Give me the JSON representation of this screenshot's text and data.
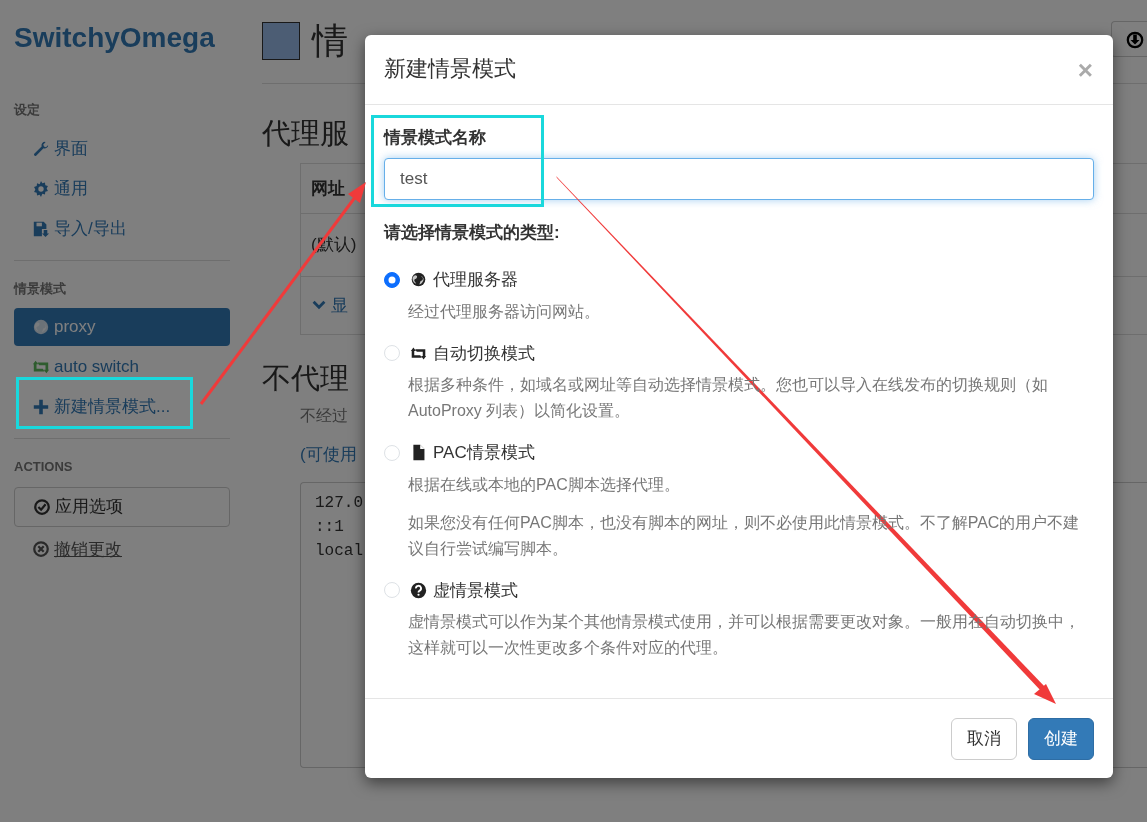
{
  "sidebar": {
    "logo": "SwitchyOmega",
    "sections": [
      {
        "header": "设定",
        "items": [
          {
            "label": "界面",
            "selected": false
          },
          {
            "label": "通用",
            "selected": false
          },
          {
            "label": "导入/导出",
            "selected": false
          }
        ]
      },
      {
        "header": "情景模式",
        "items": [
          {
            "label": "proxy",
            "selected": true
          },
          {
            "label": "auto switch",
            "selected": false
          },
          {
            "label": "新建情景模式...",
            "selected": false
          }
        ]
      }
    ],
    "actions_header": "ACTIONS",
    "actions": [
      {
        "label": "应用选项",
        "kind": "button"
      },
      {
        "label": "撤销更改",
        "kind": "link"
      }
    ]
  },
  "main": {
    "title": "情",
    "section_1": "代理服",
    "table_header": "网址",
    "table_cell": "(默认)",
    "toggle": "显",
    "section_2": "不代理",
    "hint": "不经过",
    "link": "(可使用",
    "bypass_list": [
      "127.0",
      "::1",
      "local"
    ]
  },
  "dialog": {
    "title": "新建情景模式",
    "close": "×",
    "name_label": "情景模式名称",
    "name_value": "test",
    "type_label": "请选择情景模式的类型:",
    "types": [
      {
        "label": "代理服务器",
        "selected": true,
        "descriptions": [
          "经过代理服务器访问网站。"
        ]
      },
      {
        "label": "自动切换模式",
        "selected": false,
        "descriptions": [
          "根据多种条件，如域名或网址等自动选择情景模式。您也可以导入在线发布的切换规则（如 AutoProxy 列表）以简化设置。"
        ]
      },
      {
        "label": "PAC情景模式",
        "selected": false,
        "descriptions": [
          "根据在线或本地的PAC脚本选择代理。",
          "如果您没有任何PAC脚本，也没有脚本的网址，则不必使用此情景模式。不了解PAC的用户不建议自行尝试编写脚本。"
        ]
      },
      {
        "label": "虚情景模式",
        "selected": false,
        "descriptions": [
          "虚情景模式可以作为某个其他情景模式使用，并可以根据需要更改对象。一般用在自动切换中，这样就可以一次性更改多个条件对应的代理。"
        ]
      }
    ],
    "buttons": [
      {
        "label": "取消",
        "kind": "default"
      },
      {
        "label": "创建",
        "kind": "primary"
      }
    ]
  }
}
